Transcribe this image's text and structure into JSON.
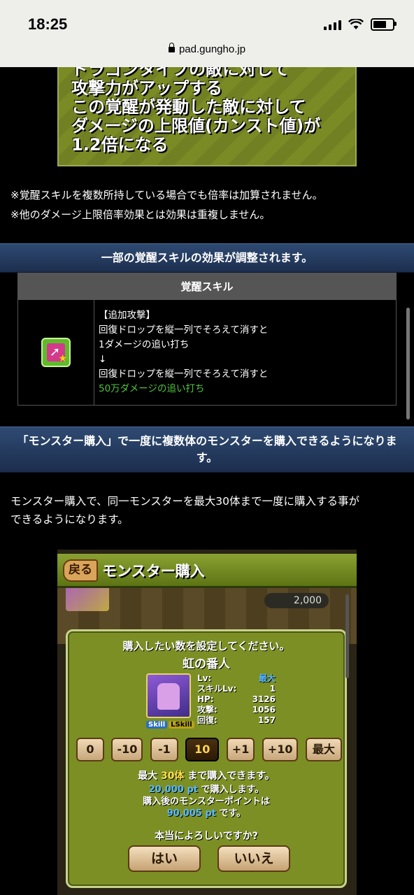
{
  "status": {
    "time": "18:25",
    "url": "pad.gungho.jp"
  },
  "awake_image": {
    "lines": [
      "ドラゴンタイプの敵に対して",
      "攻撃力がアップする",
      "この覚醒が発動した敵に対して",
      "ダメージの上限値(カンスト値)が",
      "1.2倍になる"
    ]
  },
  "notes": [
    "※覚醒スキルを複数所持している場合でも倍率は加算されません。",
    "※他のダメージ上限倍率効果とは効果は重複しません。"
  ],
  "section1": {
    "heading": "一部の覚醒スキルの効果が調整されます。",
    "table_header": "覚醒スキル",
    "lines": [
      "【追加攻撃】",
      "回復ドロップを縦一列でそろえて消すと",
      "1ダメージの追い打ち",
      "↓",
      "回復ドロップを縦一列でそろえて消すと",
      "50万ダメージの追い打ち"
    ]
  },
  "section2": {
    "heading_line1": "「モンスター購入」で一度に複数体のモンスターを購入できるようになりま",
    "heading_line2": "す。",
    "intro_line1": "モンスター購入で、同一モンスターを最大30体まで一度に購入する事が",
    "intro_line2": "できるようになります。"
  },
  "game": {
    "back": "戻る",
    "title": "モンスター購入",
    "points": "2,000",
    "prompt": "購入したい数を設定してください。",
    "monster_name": "虹の番人",
    "badge_skill": "Skill",
    "badge_lskill": "LSkill",
    "stats": [
      {
        "label": "Lv:",
        "value": "最大"
      },
      {
        "label": "スキルLv:",
        "value": "1"
      },
      {
        "label": "HP:",
        "value": "3126"
      },
      {
        "label": "攻撃:",
        "value": "1056"
      },
      {
        "label": "回復:",
        "value": "157"
      }
    ],
    "buttons": [
      "0",
      "-10",
      "-1",
      "10",
      "+1",
      "+10",
      "最大"
    ],
    "max_prefix": "最大",
    "max_value": "30体",
    "max_suffix": "まで購入できます。",
    "cost_value": "20,000 pt",
    "cost_suffix": "で購入します。",
    "after_label": "購入後のモンスターポイントは",
    "after_value": "90,005 pt",
    "after_suffix": "です。",
    "confirm": "本当によろしいですか?",
    "yes": "はい",
    "no": "いいえ"
  }
}
